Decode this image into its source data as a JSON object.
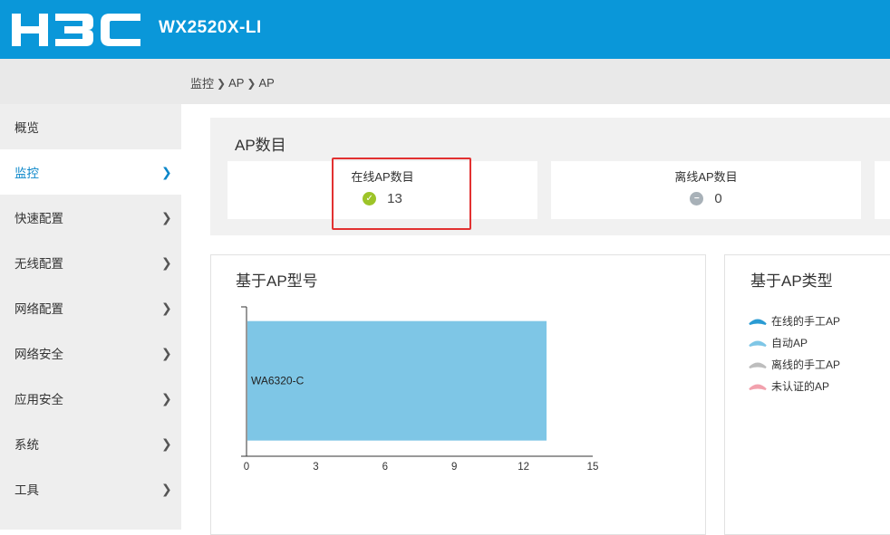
{
  "header": {
    "logo_text": "H3C",
    "device_name": "WX2520X-LI"
  },
  "breadcrumb": [
    "监控",
    "AP",
    "AP"
  ],
  "sidebar": {
    "items": [
      {
        "label": "概览",
        "has_arrow": false,
        "active": false
      },
      {
        "label": "监控",
        "has_arrow": true,
        "active": true
      },
      {
        "label": "快速配置",
        "has_arrow": true,
        "active": false
      },
      {
        "label": "无线配置",
        "has_arrow": true,
        "active": false
      },
      {
        "label": "网络配置",
        "has_arrow": true,
        "active": false
      },
      {
        "label": "网络安全",
        "has_arrow": true,
        "active": false
      },
      {
        "label": "应用安全",
        "has_arrow": true,
        "active": false
      },
      {
        "label": "系统",
        "has_arrow": true,
        "active": false
      },
      {
        "label": "工具",
        "has_arrow": true,
        "active": false
      }
    ]
  },
  "ap_count": {
    "title": "AP数目",
    "online": {
      "label": "在线AP数目",
      "value": "13",
      "status_color": "#9dc428",
      "icon": "check-circle-icon"
    },
    "offline": {
      "label": "离线AP数目",
      "value": "0",
      "status_color": "#a8b1b8",
      "icon": "minus-circle-icon"
    }
  },
  "model_chart": {
    "title": "基于AP型号"
  },
  "type_panel": {
    "title": "基于AP类型",
    "legend": [
      {
        "label": "在线的手工AP",
        "color": "#2a9bd3"
      },
      {
        "label": "自动AP",
        "color": "#7ec6e6"
      },
      {
        "label": "离线的手工AP",
        "color": "#bdbdbd"
      },
      {
        "label": "未认证的AP",
        "color": "#f2a1ad"
      }
    ]
  },
  "chart_data": {
    "type": "bar",
    "orientation": "horizontal",
    "categories": [
      "WA6320-C"
    ],
    "values": [
      13
    ],
    "xlim": [
      0,
      15
    ],
    "xticks": [
      "0",
      "3",
      "6",
      "9",
      "12",
      "15"
    ],
    "bar_color": "#7ec6e6",
    "title": "基于AP型号"
  }
}
